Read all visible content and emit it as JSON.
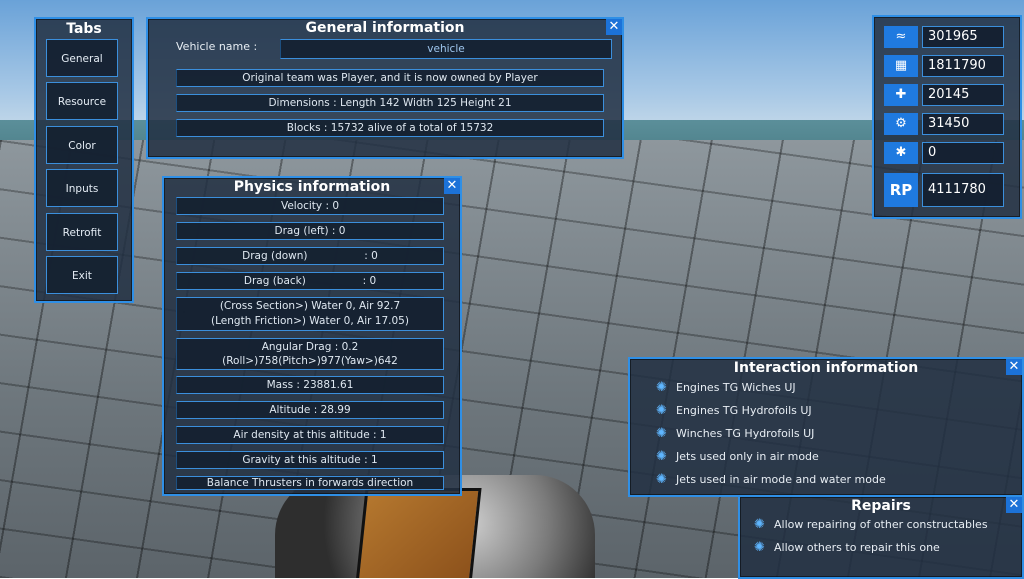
{
  "tabs": {
    "title": "Tabs",
    "items": [
      "General",
      "Resource",
      "Color",
      "Inputs",
      "Retrofit",
      "Exit"
    ]
  },
  "general": {
    "title": "General information",
    "vehicle_label": "Vehicle name :",
    "vehicle_value": "vehicle",
    "rows": [
      "Original team was Player, and it is now owned by Player",
      "Dimensions : Length 142 Width 125 Height 21",
      "Blocks : 15732 alive of a total of 15732"
    ]
  },
  "physics": {
    "title": "Physics information",
    "rows": [
      "Velocity : 0",
      "Drag (left) : 0",
      "Drag (down)                 : 0",
      "Drag (back)                 : 0",
      "(Cross Section>) Water 0, Air 92.7            (Length Friction>) Water 0, Air 17.05)",
      "Angular Drag : 0.2 (Roll>)758(Pitch>)977(Yaw>)642",
      "Mass : 23881.61",
      "Altitude : 28.99",
      "Air density at this altitude : 1",
      "Gravity at this altitude : 1",
      "Balance Thrusters in forwards direction"
    ]
  },
  "resources": [
    {
      "icon": "material-icon",
      "glyph": "≈",
      "value": "301965"
    },
    {
      "icon": "ammo-icon",
      "glyph": "▦",
      "value": "1811790"
    },
    {
      "icon": "fuel-icon",
      "glyph": "✚",
      "value": "20145"
    },
    {
      "icon": "energy-icon",
      "glyph": "⚙",
      "value": "31450"
    },
    {
      "icon": "research-icon",
      "glyph": "✱",
      "value": "0"
    },
    {
      "icon": "rp-icon",
      "glyph": "RP",
      "value": "4111780"
    }
  ],
  "interaction": {
    "title": "Interaction information",
    "items": [
      "Engines TG Wiches UJ",
      "Engines TG Hydrofoils UJ",
      "Winches TG Hydrofoils UJ",
      "Jets used only in air mode",
      "Jets used in air mode and water mode"
    ]
  },
  "repairs": {
    "title": "Repairs",
    "items": [
      "Allow repairing of other constructables",
      "Allow others to repair this one"
    ]
  },
  "close_glyph": "✕",
  "colors": {
    "accent": "#2f8fe6",
    "panel": "#223042",
    "icon_fill": "#1f7ae0"
  }
}
